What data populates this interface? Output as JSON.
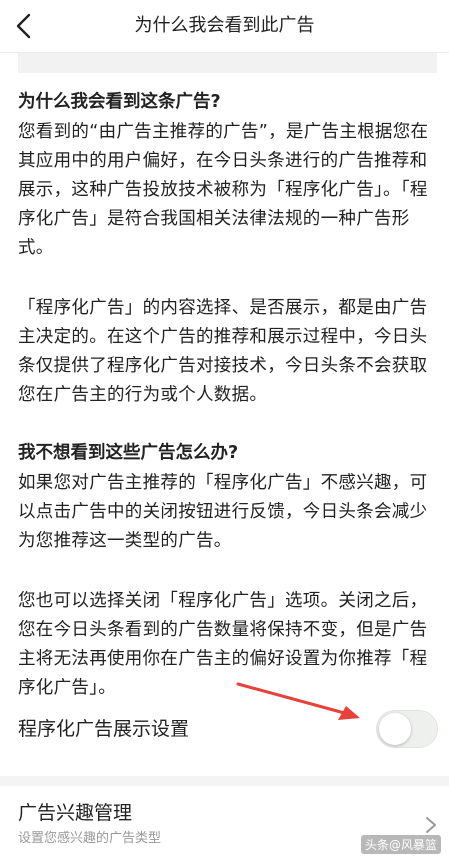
{
  "header": {
    "title": "为什么我会看到此广告",
    "back_icon": "chevron-left-icon"
  },
  "sections": [
    {
      "heading": "为什么我会看到这条广告?",
      "paragraphs": [
        "您看到的“由广告主推荐的广告”，是广告主根据您在其应用中的用户偏好，在今日头条进行的广告推荐和展示，这种广告投放技术被称为「程序化广告」。「程序化广告」是符合我国相关法律法规的一种广告形式。",
        "「程序化广告」的内容选择、是否展示，都是由广告主决定的。在这个广告的推荐和展示过程中，今日头条仅提供了程序化广告对接技术，今日头条不会获取您在广告主的行为或个人数据。"
      ]
    },
    {
      "heading": "我不想看到这些广告怎么办?",
      "paragraphs": [
        "如果您对广告主推荐的「程序化广告」不感兴趣，可以点击广告中的关闭按钮进行反馈，今日头条会减少为您推荐这一类型的广告。",
        "您也可以选择关闭「程序化广告」选项。关闭之后，您在今日头条看到的广告数量将保持不变，但是广告主将无法再使用你在广告主的偏好设置为你推荐「程序化广告」。"
      ]
    }
  ],
  "settings": {
    "programmatic_label": "程序化广告展示设置",
    "programmatic_enabled": false,
    "interest_title": "广告兴趣管理",
    "interest_subtitle": "设置您感兴趣的广告类型"
  },
  "watermark": "头条@风暴篮",
  "colors": {
    "annotation_arrow": "#e8403a",
    "toggle_off_track": "#eef0ee",
    "subtitle_text": "#999999"
  }
}
